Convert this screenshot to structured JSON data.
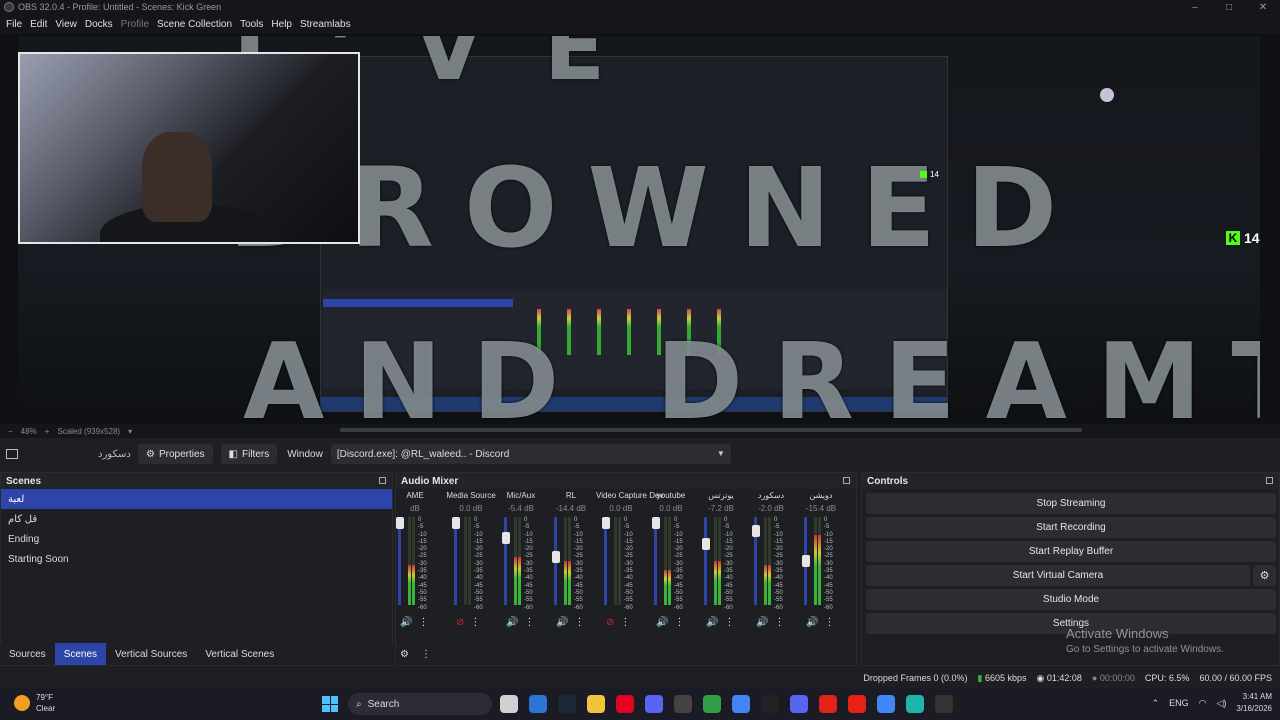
{
  "window": {
    "title": "OBS 32.0.4 - Profile: Untitled - Scenes: Kick Green",
    "minimize": "–",
    "maximize": "□",
    "close": "✕"
  },
  "menu": [
    "File",
    "Edit",
    "View",
    "Docks",
    "Profile",
    "Scene Collection",
    "Tools",
    "Help",
    "Streamlabs"
  ],
  "preview": {
    "overlay_line1": "DROWNED",
    "overlay_line2": "AND DREAMT",
    "overlay_line0": "I'VE",
    "kick_count": "14",
    "kick_count_small": "14",
    "zoom": "48%",
    "scale": "Scaled (939x528)"
  },
  "source_toolbar": {
    "source_name": "دسكورد",
    "properties": "Properties",
    "filters": "Filters",
    "window_label": "Window",
    "window_value": "[Discord.exe]: @RL_waleed.. - Discord"
  },
  "scenes": {
    "title": "Scenes",
    "items": [
      "لعبة",
      "قل كام",
      "Ending",
      "Starting Soon"
    ],
    "active_index": 0
  },
  "tabs": [
    "Sources",
    "Scenes",
    "Vertical Sources",
    "Vertical Scenes"
  ],
  "active_tab": "Scenes",
  "mixer": {
    "title": "Audio Mixer",
    "scale": [
      "0",
      "-5",
      "-10",
      "-15",
      "-20",
      "-25",
      "-30",
      "-35",
      "-40",
      "-45",
      "-50",
      "-55",
      "-60"
    ],
    "channels": [
      {
        "name": "AME",
        "db": "dB",
        "level": 0.45,
        "fader": 1.0,
        "muted": false
      },
      {
        "name": "Media Source",
        "db": "0.0 dB",
        "level": 0.0,
        "fader": 1.0,
        "muted": true
      },
      {
        "name": "Mic/Aux",
        "db": "-5.4 dB",
        "level": 0.55,
        "fader": 0.8,
        "muted": false
      },
      {
        "name": "RL",
        "db": "-14.4 dB",
        "level": 0.5,
        "fader": 0.55,
        "muted": false
      },
      {
        "name": "Video Capture Dev",
        "db": "0.0 dB",
        "level": 0.0,
        "fader": 1.0,
        "muted": true
      },
      {
        "name": "youtube",
        "db": "0.0 dB",
        "level": 0.4,
        "fader": 1.0,
        "muted": false
      },
      {
        "name": "يوترتس",
        "db": "-7.2 dB",
        "level": 0.5,
        "fader": 0.72,
        "muted": false
      },
      {
        "name": "دسكورد",
        "db": "-2.0 dB",
        "level": 0.45,
        "fader": 0.9,
        "muted": false
      },
      {
        "name": "دويشن",
        "db": "-15.4 dB",
        "level": 0.8,
        "fader": 0.5,
        "muted": false
      }
    ]
  },
  "controls": {
    "title": "Controls",
    "buttons": [
      "Stop Streaming",
      "Start Recording",
      "Start Replay Buffer",
      "Start Virtual Camera",
      "Studio Mode",
      "Settings"
    ]
  },
  "activation": {
    "line1": "Activate Windows",
    "line2": "Go to Settings to activate Windows."
  },
  "status": {
    "dropped": "Dropped Frames 0 (0.0%)",
    "bitrate": "6605 kbps",
    "stream_time": "01:42:08",
    "rec_time": "00:00:00",
    "cpu": "CPU: 6.5%",
    "fps": "60.00 / 60.00 FPS"
  },
  "taskbar": {
    "temp": "79°F",
    "weather": "Clear",
    "search": "Search",
    "lang": "ENG",
    "time": "3:41 AM",
    "date": "3/16/2026"
  },
  "colors": {
    "accent": "#2d45a8",
    "kick_green": "#53fc18",
    "meter_green": "#3ab33a"
  }
}
